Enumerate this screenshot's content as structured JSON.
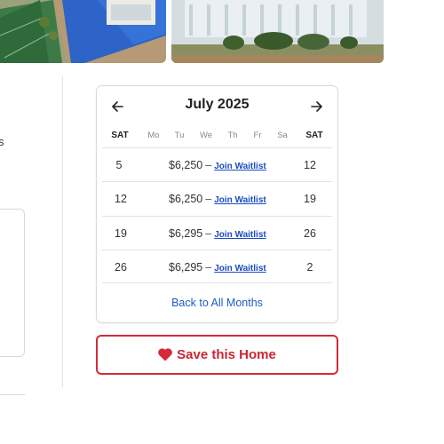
{
  "left_fragment": {
    "text": "s"
  },
  "calendar": {
    "title": "July 2025",
    "weekdays": [
      "SAT",
      "Mo",
      "Tu",
      "We",
      "Th",
      "Fr",
      "Sa",
      "SAT"
    ],
    "rows": [
      {
        "start": "5",
        "price": "$6,250",
        "dash": "–",
        "action": "Join Waitlist",
        "end": "12"
      },
      {
        "start": "12",
        "price": "$6,250",
        "dash": "–",
        "action": "Join Waitlist",
        "end": "19"
      },
      {
        "start": "19",
        "price": "$6,295",
        "dash": "–",
        "action": "Join Waitlist",
        "end": "26"
      },
      {
        "start": "26",
        "price": "$6,295",
        "dash": "–",
        "action": "Join Waitlist",
        "end": "2"
      }
    ],
    "back_link": "Back to All Months"
  },
  "save_button": {
    "label": "Save this Home"
  },
  "colors": {
    "accent_red": "#d22a3a",
    "link_blue": "#1a4cc2"
  },
  "icons": {
    "prev": "arrow-left-icon",
    "next": "arrow-right-icon",
    "heart": "heart-icon"
  }
}
